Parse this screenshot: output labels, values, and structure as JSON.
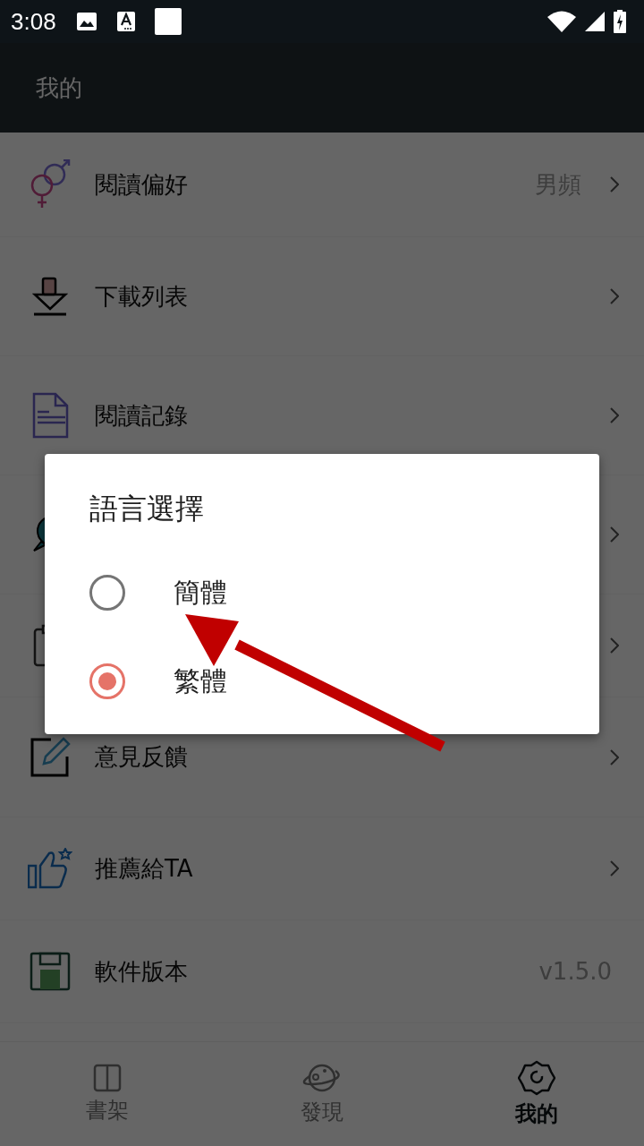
{
  "status_bar": {
    "time": "3:08"
  },
  "header": {
    "title": "我的"
  },
  "menu": [
    {
      "label": "閱讀偏好",
      "value": "男頻",
      "chevron": true
    },
    {
      "label": "下載列表",
      "chevron": true
    },
    {
      "label": "閱讀記錄",
      "chevron": true
    },
    {
      "chevron": true
    },
    {
      "chevron": true
    },
    {
      "label": "意見反饋",
      "chevron": true
    },
    {
      "label": "推薦給TA",
      "chevron": true
    },
    {
      "label": "軟件版本",
      "value": "v1.5.0",
      "chevron": false
    }
  ],
  "dialog": {
    "title": "語言選擇",
    "options": [
      {
        "label": "簡體",
        "selected": false
      },
      {
        "label": "繁體",
        "selected": true
      }
    ]
  },
  "bottom_nav": [
    {
      "label": "書架",
      "selected": false
    },
    {
      "label": "發現",
      "selected": false
    },
    {
      "label": "我的",
      "selected": true
    }
  ]
}
